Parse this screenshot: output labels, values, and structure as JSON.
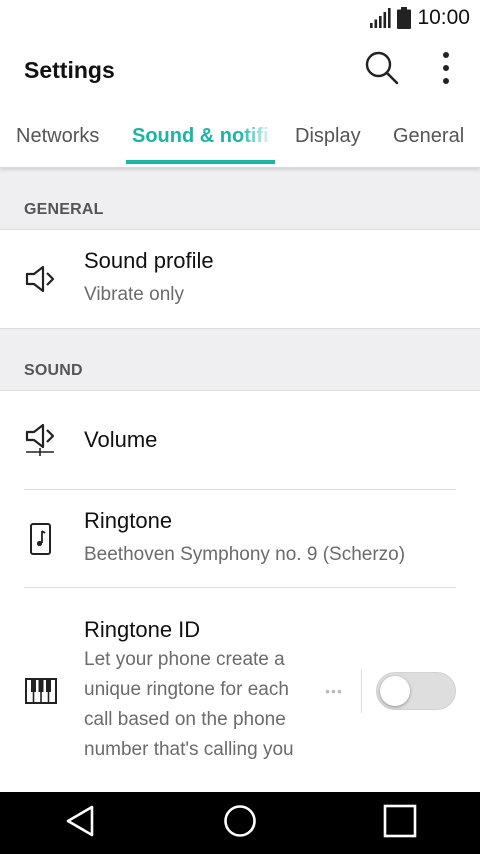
{
  "status_bar": {
    "time": "10:00",
    "icons": [
      "signal-icon",
      "battery-icon"
    ]
  },
  "app_bar": {
    "title": "Settings",
    "actions": [
      "search-icon",
      "more-vert-icon"
    ]
  },
  "tabs": [
    {
      "label": "Networks",
      "selected": false
    },
    {
      "label": "Sound & notifi",
      "selected": true
    },
    {
      "label": "Display",
      "selected": false
    },
    {
      "label": "General",
      "selected": false
    }
  ],
  "sections": {
    "general": {
      "header": "GENERAL",
      "items": [
        {
          "icon": "speaker-icon",
          "title": "Sound profile",
          "summary": "Vibrate only"
        }
      ]
    },
    "sound": {
      "header": "SOUND",
      "items": [
        {
          "icon": "volume-icon",
          "title": "Volume"
        },
        {
          "icon": "music-note-icon",
          "title": "Ringtone",
          "summary": "Beethoven Symphony no. 9 (Scherzo)"
        },
        {
          "icon": "piano-keys-icon",
          "title": "Ringtone ID",
          "summary": "Let your phone create a unique ringtone for each call based on the phone number that's calling you",
          "toggle_on": false
        }
      ]
    }
  },
  "colors": {
    "accent": "#1ab5a6",
    "section_bg": "#efeff2",
    "nav_bg": "#000000"
  },
  "nav_bar": [
    "back-icon",
    "home-icon",
    "recents-icon"
  ]
}
